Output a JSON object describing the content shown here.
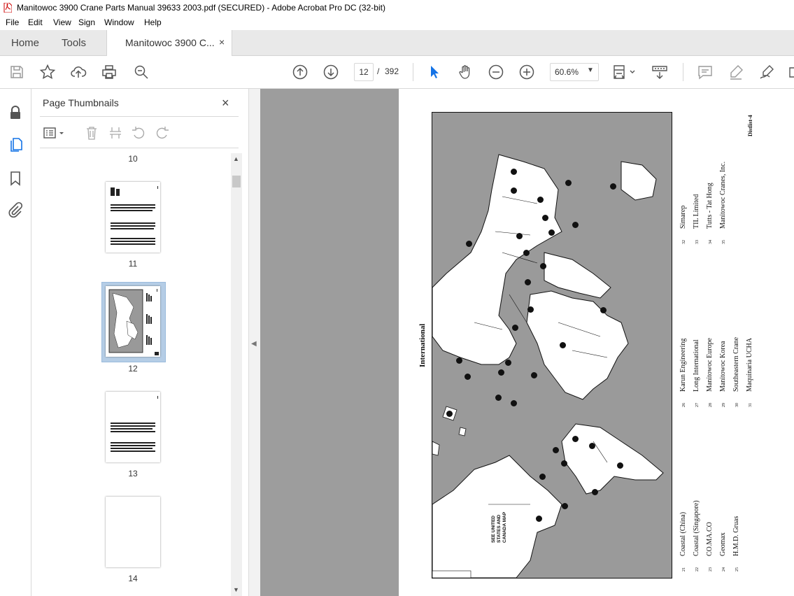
{
  "window": {
    "title": "Manitowoc 3900 Crane Parts Manual 39633 2003.pdf (SECURED) - Adobe Acrobat Pro DC (32-bit)"
  },
  "menu": [
    "File",
    "Edit",
    "View",
    "Sign",
    "Window",
    "Help"
  ],
  "tabs": {
    "home": "Home",
    "tools": "Tools",
    "document": "Manitowoc 3900 C...",
    "close": "×"
  },
  "toolbar": {
    "current_page": "12",
    "separator": "/",
    "total_pages": "392",
    "zoom": "60.6%",
    "icons": [
      "save-icon",
      "star-icon",
      "upload-icon",
      "print-icon",
      "search-icon",
      "page-up-icon",
      "page-down-icon",
      "select-cursor-icon",
      "hand-icon",
      "zoom-out-icon",
      "zoom-in-icon",
      "fit-page-icon",
      "scroll-mode-icon",
      "comment-icon",
      "highlight-icon",
      "sign-icon"
    ]
  },
  "left_rail": [
    "lock-icon",
    "page-thumbnails-icon",
    "bookmark-icon",
    "attachment-icon"
  ],
  "panel": {
    "title": "Page Thumbnails",
    "close": "×",
    "thumbnails": [
      {
        "page": "10"
      },
      {
        "page": "11"
      },
      {
        "page": "12",
        "selected": true
      },
      {
        "page": "13"
      },
      {
        "page": "14"
      }
    ]
  },
  "document": {
    "page_header": "Distlist-4",
    "map_title": "International",
    "map_callout": [
      "SEE UNITED",
      "STATES AND",
      "CANADA MAP"
    ],
    "legend_col1": [
      {
        "num": "21",
        "name": "Coastal (China)"
      },
      {
        "num": "22",
        "name": "Coastal (Singapore)"
      },
      {
        "num": "23",
        "name": "CO.MA.CO"
      },
      {
        "num": "24",
        "name": "Geomax"
      },
      {
        "num": "25",
        "name": "H.M.D. Gruas"
      }
    ],
    "legend_col2": [
      {
        "num": "26",
        "name": "Karun Engineering"
      },
      {
        "num": "27",
        "name": "Long International"
      },
      {
        "num": "28",
        "name": "Manitowoc Europe"
      },
      {
        "num": "29",
        "name": "Manitowoc Korea"
      },
      {
        "num": "30",
        "name": "Southeastern Crane"
      },
      {
        "num": "31",
        "name": "Maquinaria UCHA"
      }
    ],
    "legend_col3": [
      {
        "num": "32",
        "name": "Simarep"
      },
      {
        "num": "33",
        "name": "TIL Limited"
      },
      {
        "num": "34",
        "name": "Tutts - Tat Hong"
      },
      {
        "num": "35",
        "name": "Manitowoc Cranes, Inc."
      }
    ]
  }
}
